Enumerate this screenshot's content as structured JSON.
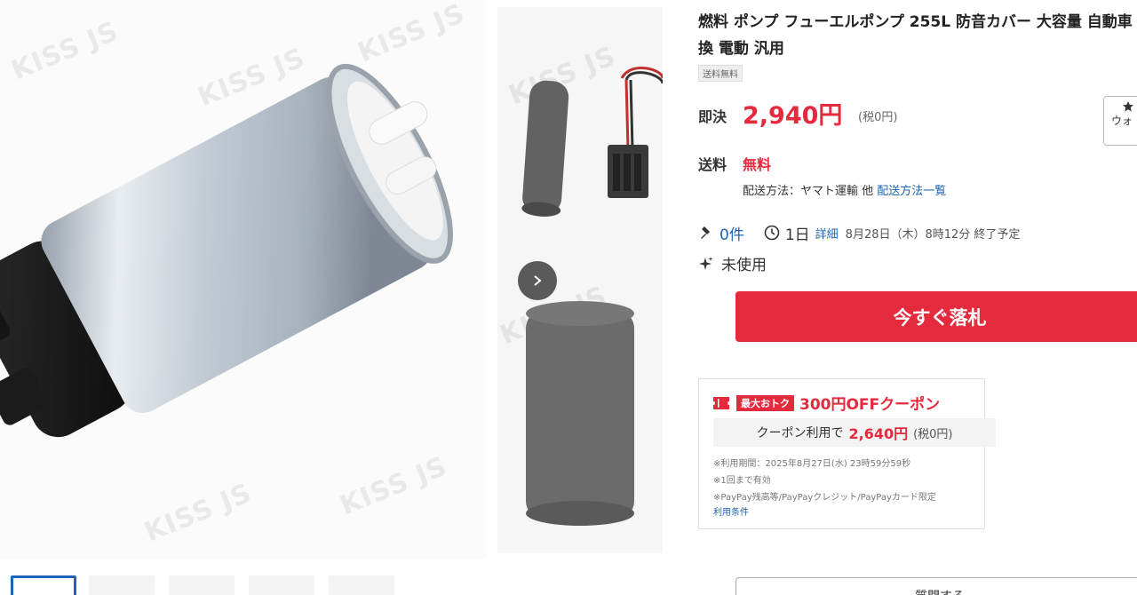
{
  "listing": {
    "title": "燃料 ポンプ フューエルポンプ 255L 防音カバー 大容量 自動車 交換 電動 汎用",
    "badge_free_shipping": "送料無料"
  },
  "price": {
    "label": "即決",
    "value": "2,940円",
    "tax_note": "(税0円)"
  },
  "watch": {
    "label": "ウォ",
    "icon": "star-icon"
  },
  "shipping": {
    "label": "送料",
    "value": "無料",
    "method_prefix": "配送方法：ヤマト運輸 他",
    "method_link": "配送方法一覧"
  },
  "meta": {
    "bids": "0件",
    "remaining": "1日",
    "detail_link": "詳細",
    "end_time": "8月28日（木）8時12分 終了予定",
    "icons": [
      "gavel-icon",
      "clock-icon"
    ]
  },
  "condition": {
    "icon": "sparkle-icon",
    "label": "未使用"
  },
  "buy_now": {
    "label": "今すぐ落札"
  },
  "coupon": {
    "tag": "最大おトク",
    "amount": "300円OFFクーポン",
    "use_prefix": "クーポン利用で",
    "use_price": "2,640円",
    "use_tax": "(税0円)",
    "notes": [
      "※利用期間：2025年8月27日(水) 23時59分59秒",
      "※1回まで有効",
      "※PayPay残高等/PayPayクレジット/PayPayカード限定"
    ],
    "terms_link": "利用条件",
    "accent": "#e42a3d"
  },
  "question_button": {
    "label": "質問する"
  },
  "gallery": {
    "watermark": "KISS JS",
    "next_icon": "chevron-right-icon",
    "thumbnail_count": 5
  },
  "colors": {
    "accent_red": "#e42a3d",
    "link_blue": "#1d64b8"
  }
}
